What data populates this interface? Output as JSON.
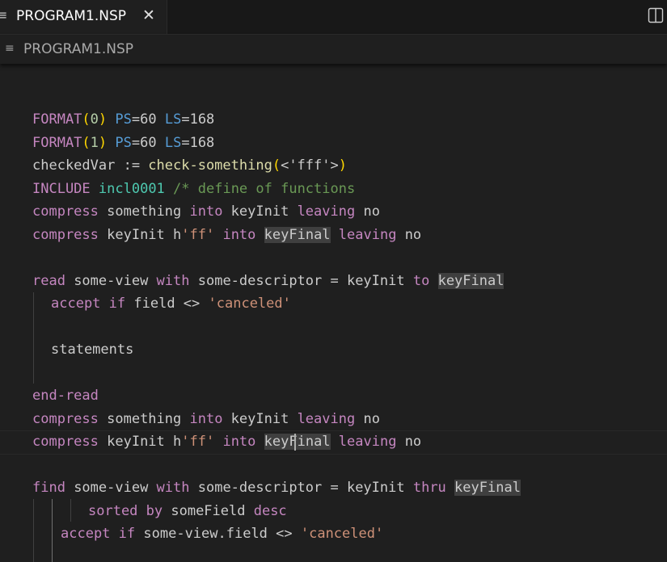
{
  "tab": {
    "label": "PROGRAM1.NSP",
    "close": "✕",
    "icon": "file-lines-icon"
  },
  "breadcrumb": {
    "label": "PROGRAM1.NSP",
    "icon": "file-lines-icon"
  },
  "code": {
    "l1": {
      "a": "FORMAT",
      "b": "(",
      "c": "0",
      "d": ")",
      "e": " ",
      "f": "PS",
      "g": "=60 ",
      "h": "LS",
      "i": "=168"
    },
    "l2": {
      "a": "FORMAT",
      "b": "(",
      "c": "1",
      "d": ")",
      "e": " ",
      "f": "PS",
      "g": "=60 ",
      "h": "LS",
      "i": "=168"
    },
    "l3": {
      "a": "checkedVar := ",
      "b": "check-something",
      "c": "(",
      "d": "<'fff'>",
      "e": ")"
    },
    "l4": {
      "a": "INCLUDE",
      "b": " ",
      "c": "incl0001",
      "d": " ",
      "e": "/* define of functions"
    },
    "l5": {
      "a": "compress",
      "b": " something ",
      "c": "into",
      "d": " keyInit ",
      "e": "leaving",
      "f": " no"
    },
    "l6": {
      "a": "compress",
      "b": " keyInit h",
      "c": "'ff'",
      "d": " ",
      "e": "into",
      "f": " ",
      "g": "keyFinal",
      "h": " ",
      "i": "leaving",
      "j": " no"
    },
    "l7": {
      "a": "read",
      "b": " some-view ",
      "c": "with",
      "d": " some-descriptor = keyInit ",
      "e": "to",
      "f": " ",
      "g": "keyFinal"
    },
    "l8": {
      "a": "accept",
      "b": " ",
      "c": "if",
      "d": " field <> ",
      "e": "'canceled'"
    },
    "l9": {
      "a": "statements"
    },
    "l10": {
      "a": "end-read"
    },
    "l11": {
      "a": "compress",
      "b": " something ",
      "c": "into",
      "d": " keyInit ",
      "e": "leaving",
      "f": " no"
    },
    "l12": {
      "a": "compress",
      "b": " keyInit h",
      "c": "'ff'",
      "d": " ",
      "e": "into",
      "f": " ",
      "g": "keyFinal",
      "h": " ",
      "i": "leaving",
      "j": " no"
    },
    "l13": {
      "a": "find",
      "b": " some-view ",
      "c": "with",
      "d": " some-descriptor = keyInit ",
      "e": "thru",
      "f": " ",
      "g": "keyFinal"
    },
    "l14": {
      "a": "sorted by",
      "b": " someField ",
      "c": "desc"
    },
    "l15": {
      "a": "accept",
      "b": " ",
      "c": "if",
      "d": " some-view.field <> ",
      "e": "'canceled'"
    }
  },
  "colors": {
    "keyword": "#c586c0",
    "function": "#dcdcaa",
    "number": "#b5cea8",
    "property": "#569cd6",
    "string": "#ce9178",
    "comment": "#6a9955",
    "type": "#4ec9b0",
    "text": "#cccccc",
    "background": "#1f1f1f"
  }
}
